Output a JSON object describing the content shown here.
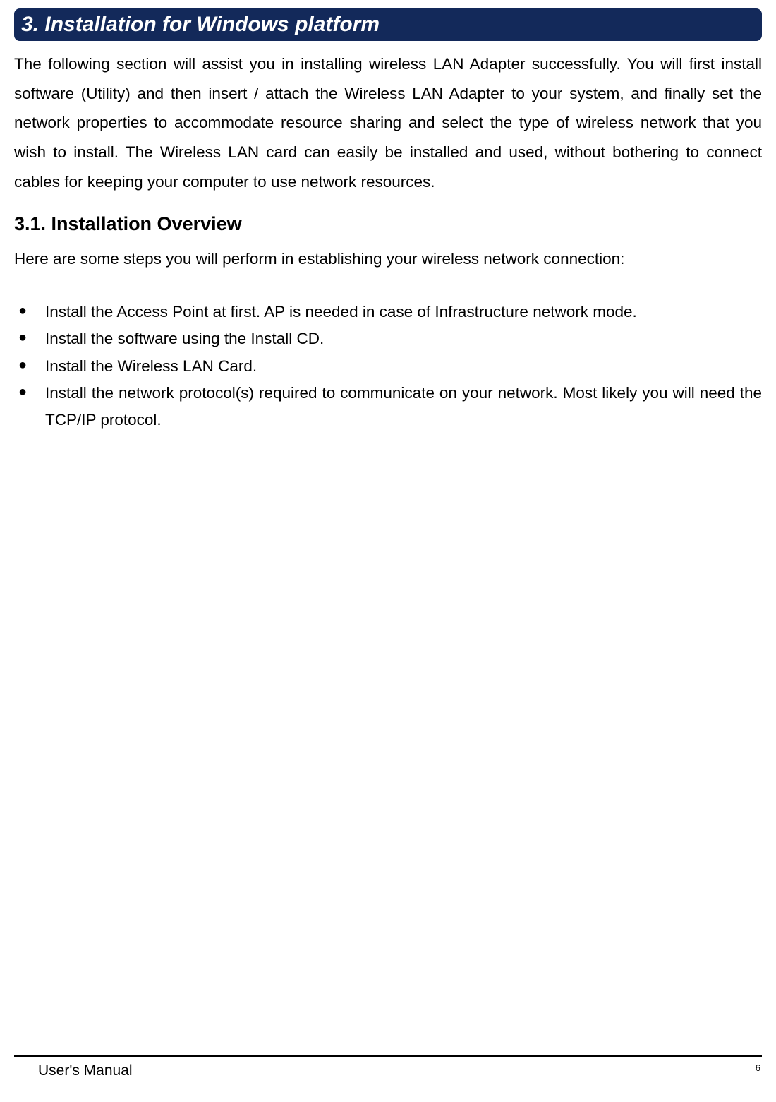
{
  "section": {
    "title": "3. Installation for Windows platform",
    "intro": "The following section will assist you in installing wireless LAN Adapter successfully. You will first install software (Utility) and then insert / attach the Wireless LAN Adapter to your system, and finally set the network properties to accommodate resource sharing and select the type of wireless network that you wish to install. The Wireless LAN card can easily be installed and used, without bothering to connect cables for keeping your computer to use network resources."
  },
  "subsection": {
    "title": "3.1. Installation Overview",
    "intro": "Here are some steps you will perform in establishing your wireless network connection:",
    "bullets": [
      "Install the Access Point at first. AP is needed in case of Infrastructure network mode.",
      "Install the software using the Install CD.",
      "Install the Wireless LAN Card.",
      "Install the network protocol(s) required to communicate on your network. Most likely you will need the TCP/IP protocol."
    ]
  },
  "footer": {
    "left": "User's Manual",
    "right": "6"
  }
}
